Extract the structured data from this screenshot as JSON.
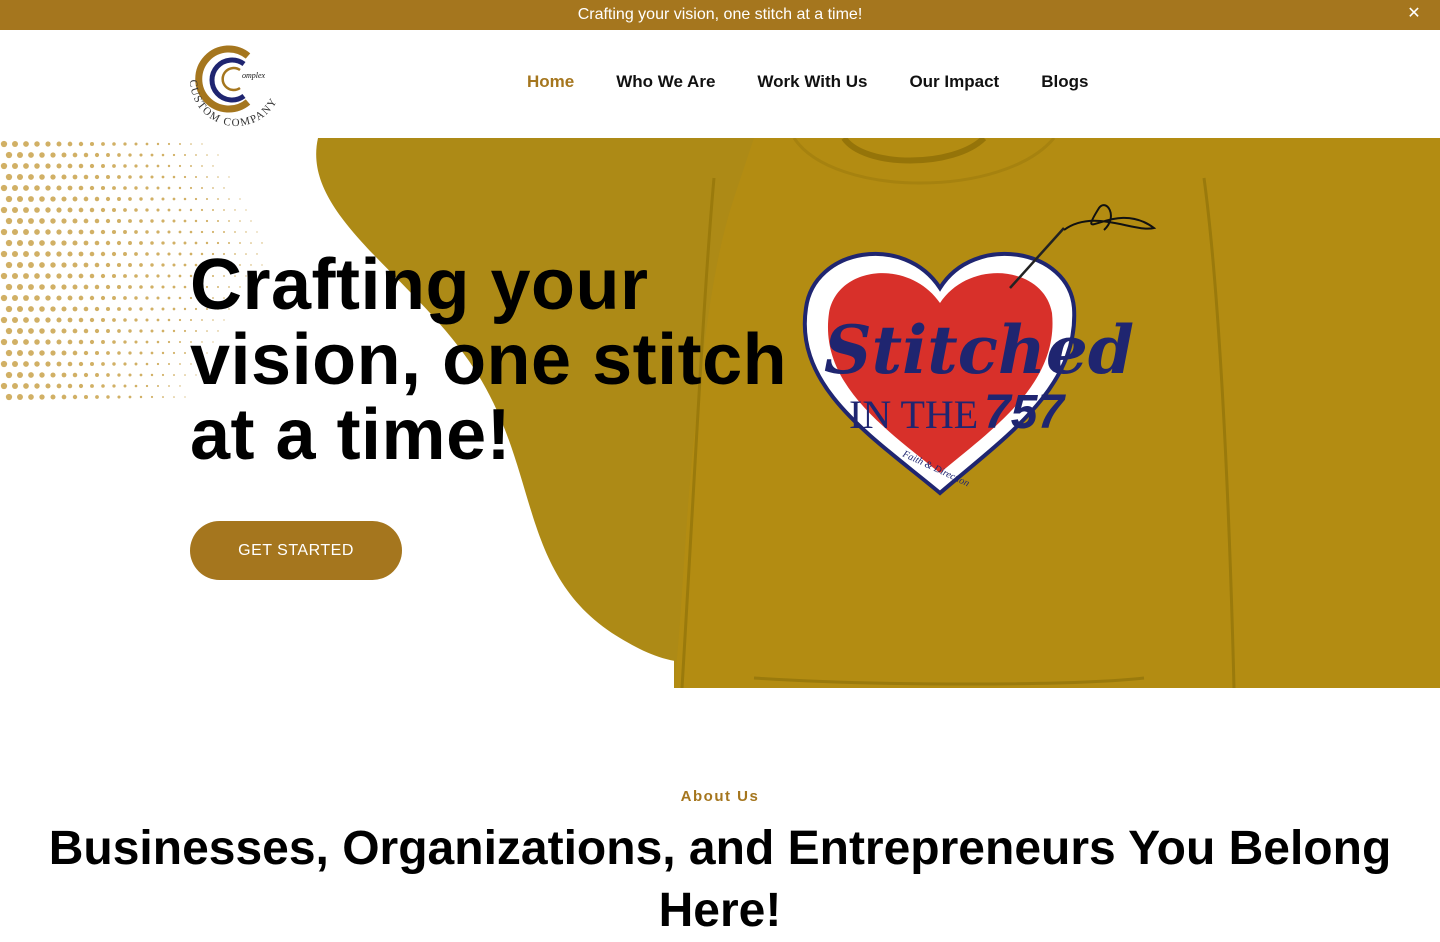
{
  "announcement": {
    "text": "Crafting your vision, one stitch at a time!",
    "close_icon": "close-icon"
  },
  "logo": {
    "mark_text": "omplex",
    "ring_text": "CUSTOM COMPANY"
  },
  "nav": {
    "items": [
      {
        "label": "Home",
        "active": true
      },
      {
        "label": "Who We Are",
        "active": false
      },
      {
        "label": "Work With Us",
        "active": false
      },
      {
        "label": "Our Impact",
        "active": false
      },
      {
        "label": "Blogs",
        "active": false
      }
    ]
  },
  "hero": {
    "title": "Crafting your vision, one stitch at a time!",
    "cta_label": "GET STARTED",
    "sweater_design": {
      "script_text": "Stitched",
      "line_text": "IN THE",
      "number_text": "757",
      "small_text": "Faith & Direction"
    }
  },
  "about": {
    "label": "About Us",
    "heading": "Businesses, Organizations, and Entrepreneurs You Belong Here!"
  },
  "colors": {
    "accent": "#a5761e",
    "blob": "#ad8a16",
    "navy": "#1f2570",
    "heart_red": "#d8302a"
  }
}
